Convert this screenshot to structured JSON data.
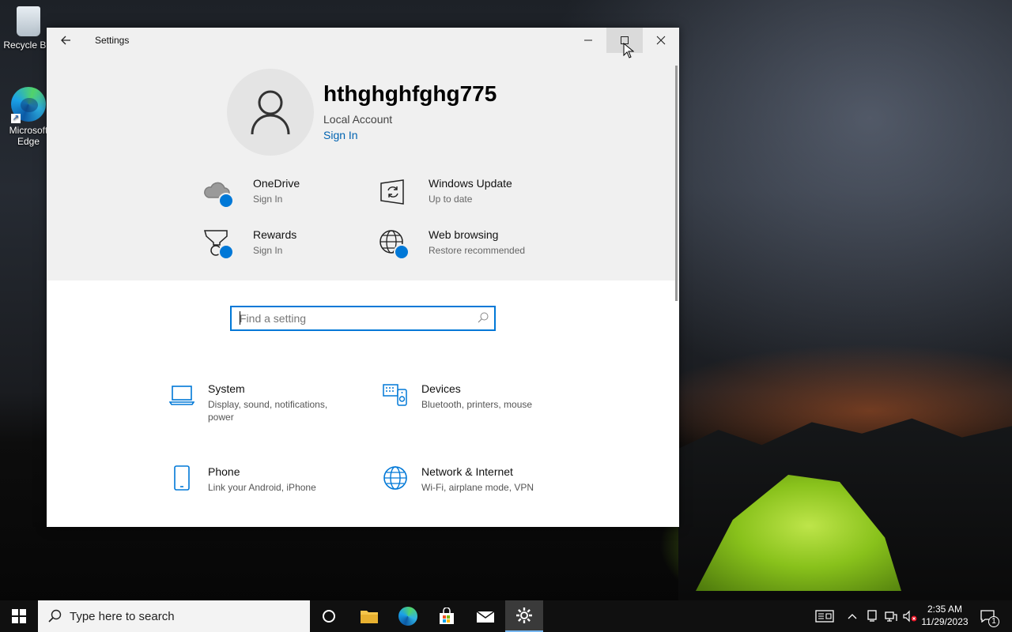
{
  "desktop": {
    "icons": [
      {
        "label": "Recycle Bin",
        "icon": "recycle-bin-icon"
      },
      {
        "label": "Microsoft Edge",
        "icon": "edge-icon"
      }
    ]
  },
  "window": {
    "title": "Settings",
    "controls": [
      "minimize-icon",
      "maximize-icon",
      "close-icon"
    ]
  },
  "account": {
    "username": "hthghghfghg775",
    "type": "Local Account",
    "signin": "Sign In"
  },
  "tiles": [
    {
      "name": "OneDrive",
      "sub": "Sign In",
      "icon": "onedrive-icon"
    },
    {
      "name": "Windows Update",
      "sub": "Up to date",
      "icon": "windows-update-icon"
    },
    {
      "name": "Rewards",
      "sub": "Sign In",
      "icon": "rewards-icon"
    },
    {
      "name": "Web browsing",
      "sub": "Restore recommended",
      "icon": "globe-icon"
    }
  ],
  "search": {
    "placeholder": "Find a setting"
  },
  "categories": [
    {
      "name": "System",
      "sub": "Display, sound, notifications, power",
      "icon": "laptop-icon"
    },
    {
      "name": "Devices",
      "sub": "Bluetooth, printers, mouse",
      "icon": "devices-icon"
    },
    {
      "name": "Phone",
      "sub": "Link your Android, iPhone",
      "icon": "phone-icon"
    },
    {
      "name": "Network & Internet",
      "sub": "Wi-Fi, airplane mode, VPN",
      "icon": "network-globe-icon"
    }
  ],
  "taskbar": {
    "search_placeholder": "Type here to search",
    "apps": [
      "cortana-icon",
      "file-explorer-icon",
      "edge-icon",
      "store-icon",
      "mail-icon",
      "settings-gear-icon"
    ],
    "clock_time": "2:35 AM",
    "clock_date": "11/29/2023",
    "notification_count": "1"
  },
  "colors": {
    "accent": "#0078d7",
    "link": "#0063b1",
    "hero_bg": "#f0f0f0"
  }
}
